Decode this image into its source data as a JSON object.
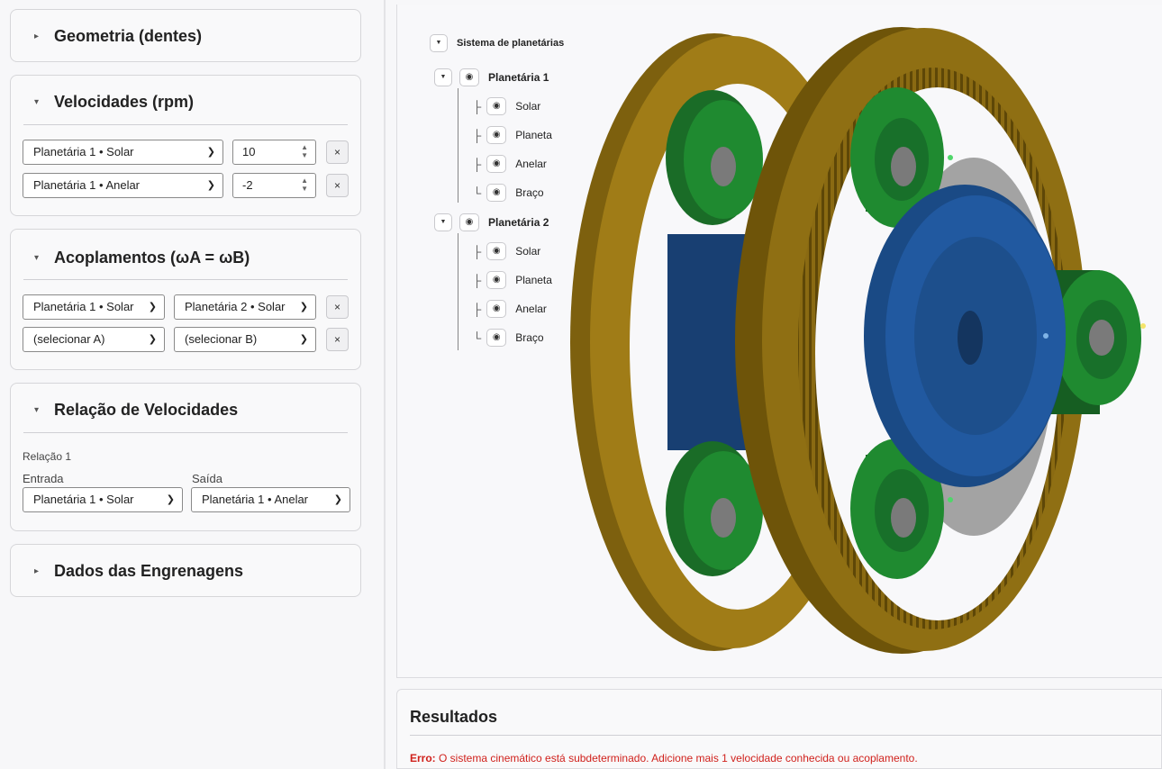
{
  "sections": {
    "geometria": {
      "title": "Geometria (dentes)",
      "expanded": false
    },
    "velocidades": {
      "title": "Velocidades (rpm)",
      "expanded": true,
      "rows": [
        {
          "element": "Planetária 1 • Solar",
          "value": "10"
        },
        {
          "element": "Planetária 1 • Anelar",
          "value": "-2"
        }
      ]
    },
    "acoplamentos": {
      "title": "Acoplamentos (ωA = ωB)",
      "expanded": true,
      "rows": [
        {
          "a": "Planetária 1 • Solar",
          "b": "Planetária 2 • Solar"
        },
        {
          "a": "(selecionar A)",
          "b": "(selecionar B)"
        }
      ]
    },
    "relacao": {
      "title": "Relação de Velocidades",
      "expanded": true,
      "relation_label": "Relação 1",
      "input_label": "Entrada",
      "output_label": "Saída",
      "input_value": "Planetária 1 • Solar",
      "output_value": "Planetária 1 • Anelar"
    },
    "dados": {
      "title": "Dados das Engrenagens",
      "expanded": false
    }
  },
  "remove_label": "×",
  "tree": {
    "root": "Sistema de planetárias",
    "groups": [
      {
        "name": "Planetária 1",
        "children": [
          "Solar",
          "Planeta",
          "Anelar",
          "Braço"
        ]
      },
      {
        "name": "Planetária 2",
        "children": [
          "Solar",
          "Planeta",
          "Anelar",
          "Braço"
        ]
      }
    ]
  },
  "results": {
    "title": "Resultados",
    "error_prefix": "Erro:",
    "error_text": "O sistema cinemático está subdeterminado. Adicione mais 1 velocidade conhecida ou acoplamento."
  },
  "colors": {
    "ring": "#8a6a12",
    "ring_dark": "#6e5409",
    "sun": "#1d4f8c",
    "planet": "#1f7a2c",
    "carrier": "#9e9e9e",
    "error": "#d0211c"
  },
  "icons": {
    "collapsed": "right-triangle-icon",
    "expanded": "down-triangle-icon",
    "eye": "eye-icon",
    "remove": "close-icon"
  }
}
